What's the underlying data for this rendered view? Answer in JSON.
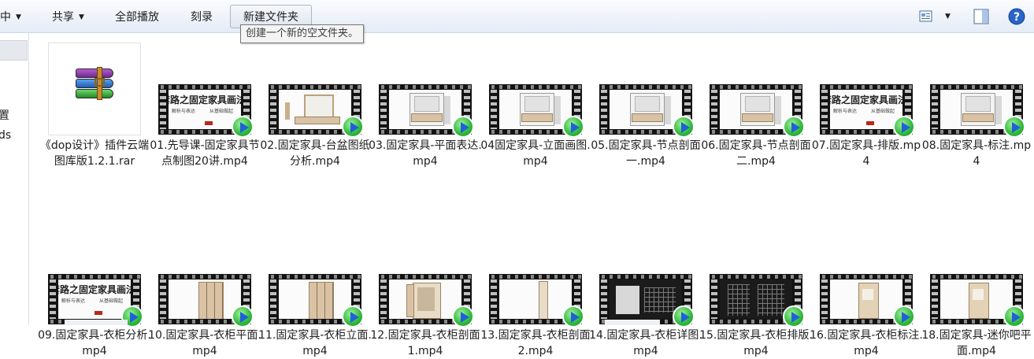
{
  "toolbar": {
    "first_cut_label": "中",
    "share_label": "共享",
    "play_all_label": "全部播放",
    "burn_label": "刻录",
    "new_folder_label": "新建文件夹",
    "tooltip_new_folder": "创建一个新的空文件夹。"
  },
  "nav": {
    "cut_text_1": "置",
    "cut_text_2": "ds"
  },
  "banner": {
    "title": "套路之固定家具画法",
    "sub_left": "解析与表达",
    "sub_right": "从基础做起"
  },
  "files": [
    {
      "name": "《dop设计》插件云端图库版1.2.1.rar",
      "type": "rar"
    },
    {
      "name": "01.先导课-固定家具节点制图20讲.mp4",
      "type": "video",
      "thumb": "banner"
    },
    {
      "name": "02.固定家具-台盆图纸分析.mp4",
      "type": "video",
      "thumb": "basin"
    },
    {
      "name": "03.固定家具-平面表达.mp4",
      "type": "video",
      "thumb": "shelf"
    },
    {
      "name": "04固定家具-立面画图.mp4",
      "type": "video",
      "thumb": "shelf"
    },
    {
      "name": "05.固定家具-节点剖面一.mp4",
      "type": "video",
      "thumb": "shelf"
    },
    {
      "name": "06.固定家具-节点剖面二.mp4",
      "type": "video",
      "thumb": "shelf"
    },
    {
      "name": "07.固定家具-排版.mp4",
      "type": "video",
      "thumb": "banner"
    },
    {
      "name": "08.固定家具-标注.mp4",
      "type": "video",
      "thumb": "shelf"
    },
    {
      "name": "09.固定家具-衣柜分析.mp4",
      "type": "video",
      "thumb": "banner"
    },
    {
      "name": "10.固定家具-衣柜平面.mp4",
      "type": "video",
      "thumb": "wardrobe"
    },
    {
      "name": "11.固定家具-衣柜立面.mp4",
      "type": "video",
      "thumb": "wardrobe"
    },
    {
      "name": "12.固定家具-衣柜剖面1.mp4",
      "type": "video",
      "thumb": "open"
    },
    {
      "name": "13.固定家具-衣柜剖面2.mp4",
      "type": "video",
      "thumb": "narrow"
    },
    {
      "name": "14.固定家具-衣柜详图.mp4",
      "type": "video",
      "thumb": "dark"
    },
    {
      "name": "15.固定家具-衣柜排版.mp4",
      "type": "video",
      "thumb": "dark2"
    },
    {
      "name": "16.固定家具-衣柜标注.mp4",
      "type": "video",
      "thumb": "tall"
    },
    {
      "name": "18.固定家具-迷你吧平面.mp4",
      "type": "video",
      "thumb": "tall"
    }
  ]
}
